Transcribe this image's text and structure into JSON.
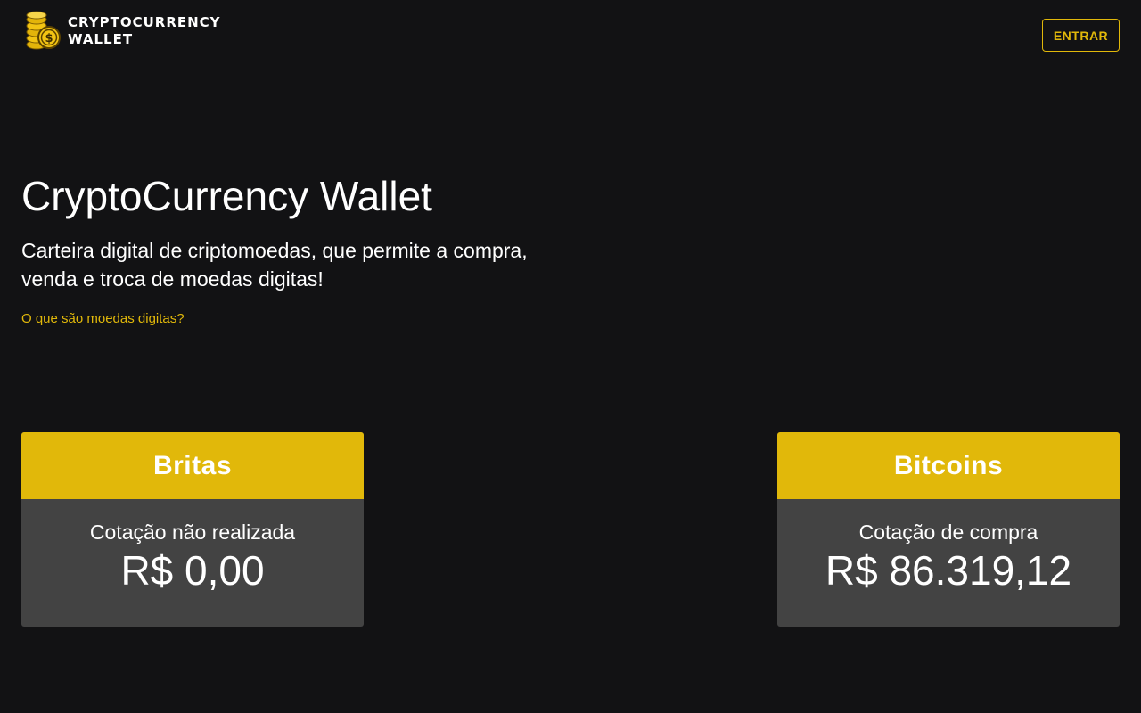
{
  "brand": {
    "logo_icon": "gold-coins-icon",
    "name_line1": "CRYPTOCURRENCY",
    "name_line2": "WALLET"
  },
  "header": {
    "login_label": "ENTRAR"
  },
  "hero": {
    "title": "CryptoCurrency Wallet",
    "subtitle": "Carteira digital de criptomoedas, que permite a compra, venda e troca de moedas digitas!",
    "link_label": "O que são moedas digitas?"
  },
  "cards": [
    {
      "name": "Britas",
      "label": "Cotação não realizada",
      "value": "R$ 0,00"
    },
    {
      "name": "Bitcoins",
      "label": "Cotação de compra",
      "value": "R$ 86.319,12"
    }
  ],
  "colors": {
    "background": "#121214",
    "accent": "#e1b80a",
    "card_body": "#434343",
    "text": "#ffffff"
  }
}
